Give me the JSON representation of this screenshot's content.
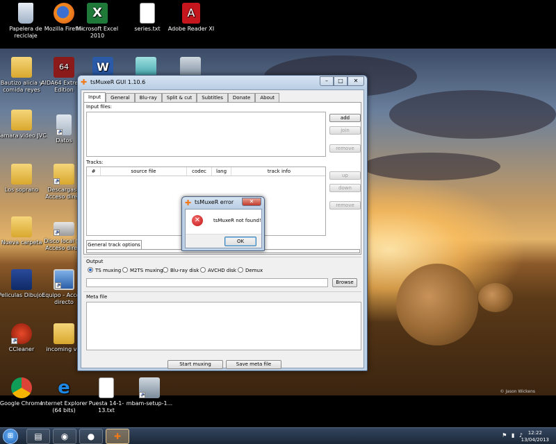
{
  "desktop": {
    "top_icons": [
      {
        "label": "Papelera de reciclaje",
        "icon": "recycle-bin-icon"
      },
      {
        "label": "Mozilla Firefox",
        "icon": "firefox-icon"
      },
      {
        "label": "Microsoft Excel 2010",
        "icon": "excel-icon"
      },
      {
        "label": "series.txt",
        "icon": "text-file-icon"
      },
      {
        "label": "Adobe Reader XI",
        "icon": "adobe-reader-icon"
      }
    ],
    "left_icons": [
      {
        "label": "Bautizo alicia y comida reyes",
        "icon": "folder-icon"
      },
      {
        "label": "AIDA64 Extreme Edition",
        "icon": "aida64-icon"
      },
      {
        "label": "Camara video JVC",
        "icon": "folder-icon"
      },
      {
        "label": "Datos",
        "icon": "folder-shortcut-icon"
      },
      {
        "label": "Los soprano",
        "icon": "folder-icon"
      },
      {
        "label": "Descargas - Acceso direct",
        "icon": "folder-shortcut-icon"
      },
      {
        "label": "Nueva carpeta",
        "icon": "folder-icon"
      },
      {
        "label": "Disco local (C) Acceso direct",
        "icon": "drive-icon"
      },
      {
        "label": "Peliculas Dibujos",
        "icon": "folder-icon"
      },
      {
        "label": "Equipo - Acceso directo",
        "icon": "computer-icon"
      },
      {
        "label": "CCleaner",
        "icon": "ccleaner-icon"
      },
      {
        "label": "incoming vie",
        "icon": "folder-icon"
      }
    ],
    "bottom_icons": [
      {
        "label": "Google Chrome",
        "icon": "chrome-icon"
      },
      {
        "label": "Internet Explorer (64 bits)",
        "icon": "internet-explorer-icon"
      },
      {
        "label": "Puesta 14-1-13.txt",
        "icon": "text-file-icon"
      },
      {
        "label": "mbam-setup-1...",
        "icon": "installer-icon"
      }
    ],
    "wallpaper_credit": "© Jason Wickens"
  },
  "window": {
    "title": "tsMuxeR GUI 1.10.6",
    "tabs": [
      "Input",
      "General",
      "Blu-ray",
      "Split & cut",
      "Subtitles",
      "Donate",
      "About"
    ],
    "active_tab": "Input",
    "input_files_label": "Input files:",
    "buttons": {
      "add": "add",
      "join": "join",
      "remove": "remove",
      "up": "up",
      "down": "down",
      "remove2": "remove"
    },
    "tracks_label": "Tracks:",
    "track_columns": [
      "#",
      "source file",
      "codec",
      "lang",
      "track info"
    ],
    "general_track_tab": "General track options",
    "output_label": "Output",
    "output_options": [
      "TS muxing",
      "M2TS muxing",
      "Blu-ray disk",
      "AVCHD disk",
      "Demux"
    ],
    "output_selected": "TS muxing",
    "output_path": "",
    "browse": "Browse",
    "meta_label": "Meta file",
    "start_button": "Start muxing",
    "save_meta_button": "Save meta file"
  },
  "dialog": {
    "title": "tsMuxeR error",
    "message": "tsMuxeR not found!",
    "ok": "OK"
  },
  "taskbar": {
    "time": "12:22",
    "date": "13/04/2013"
  }
}
